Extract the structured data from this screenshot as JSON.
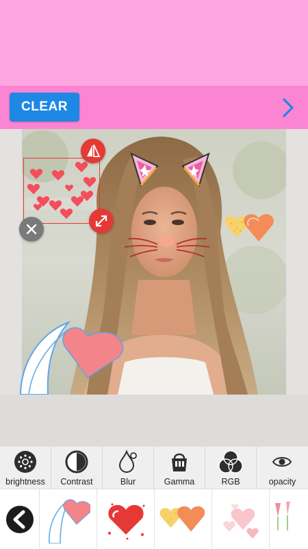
{
  "action_bar": {
    "clear_label": "CLEAR"
  },
  "tools": [
    {
      "label": "brightness",
      "icon": "brightness-icon"
    },
    {
      "label": "Contrast",
      "icon": "contrast-icon"
    },
    {
      "label": "Blur",
      "icon": "blur-icon"
    },
    {
      "label": "Gamma",
      "icon": "gamma-icon"
    },
    {
      "label": "RGB",
      "icon": "rgb-icon"
    },
    {
      "label": "opacity",
      "icon": "opacity-icon"
    }
  ],
  "stickers": [
    "heart-swoosh-sticker",
    "red-heart-sticker",
    "two-hearts-sticker",
    "faded-hearts-sticker",
    "tulips-sticker"
  ],
  "colors": {
    "banner": "#fda6e1",
    "action_bar": "#fb84d3",
    "clear_button": "#1e88e5",
    "next_arrow": "#1e88e5",
    "handle_red": "#e53935"
  }
}
